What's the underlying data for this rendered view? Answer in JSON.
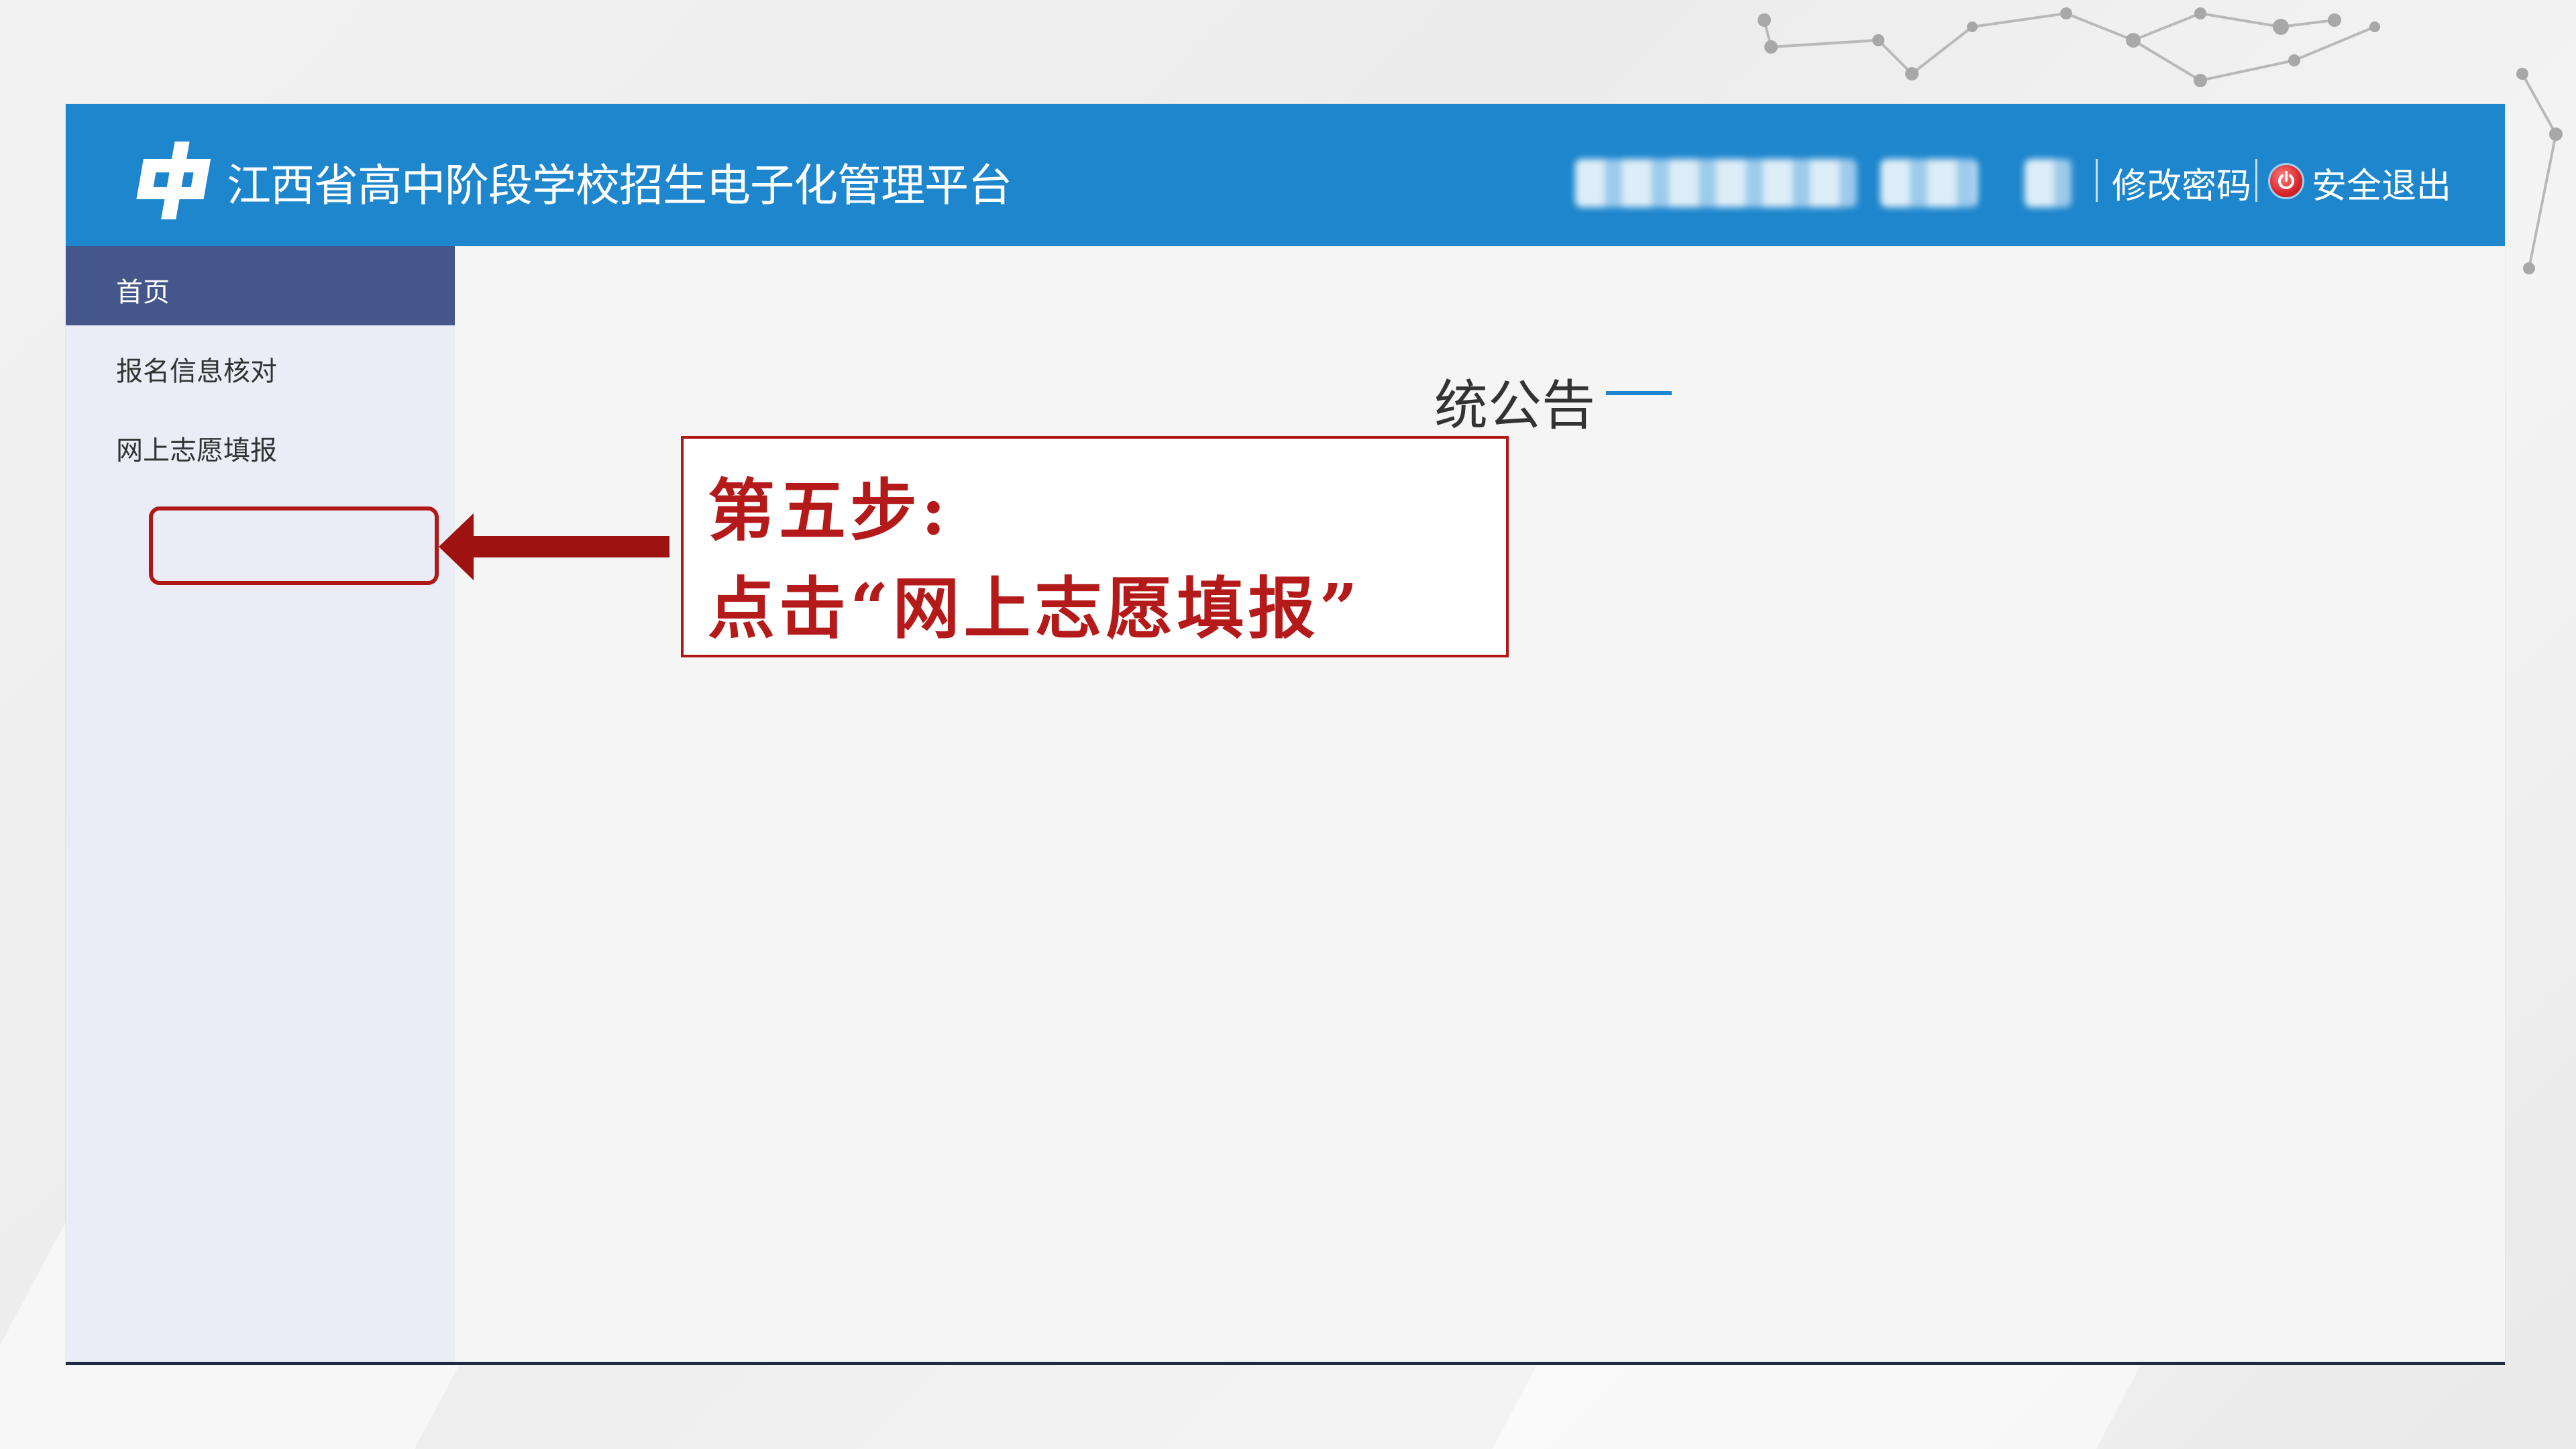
{
  "header": {
    "app_title": "江西省高中阶段学校招生电子化管理平台",
    "change_password": "修改密码",
    "logout": "安全退出",
    "logo_icon": "platform-logo-icon",
    "logout_icon": "power-icon"
  },
  "sidebar": {
    "items": [
      {
        "label": "首页",
        "active": true
      },
      {
        "label": "报名信息核对",
        "active": false
      },
      {
        "label": "网上志愿填报",
        "active": false
      }
    ]
  },
  "main": {
    "notice_title": "统公告"
  },
  "annotation": {
    "line1": "第五步:",
    "line2": "点击“网上志愿填报”",
    "color": "#b01818"
  },
  "colors": {
    "header_bg": "#1e86cc",
    "sidebar_active_bg": "#45568a",
    "sidebar_bg": "#ebedf6"
  }
}
